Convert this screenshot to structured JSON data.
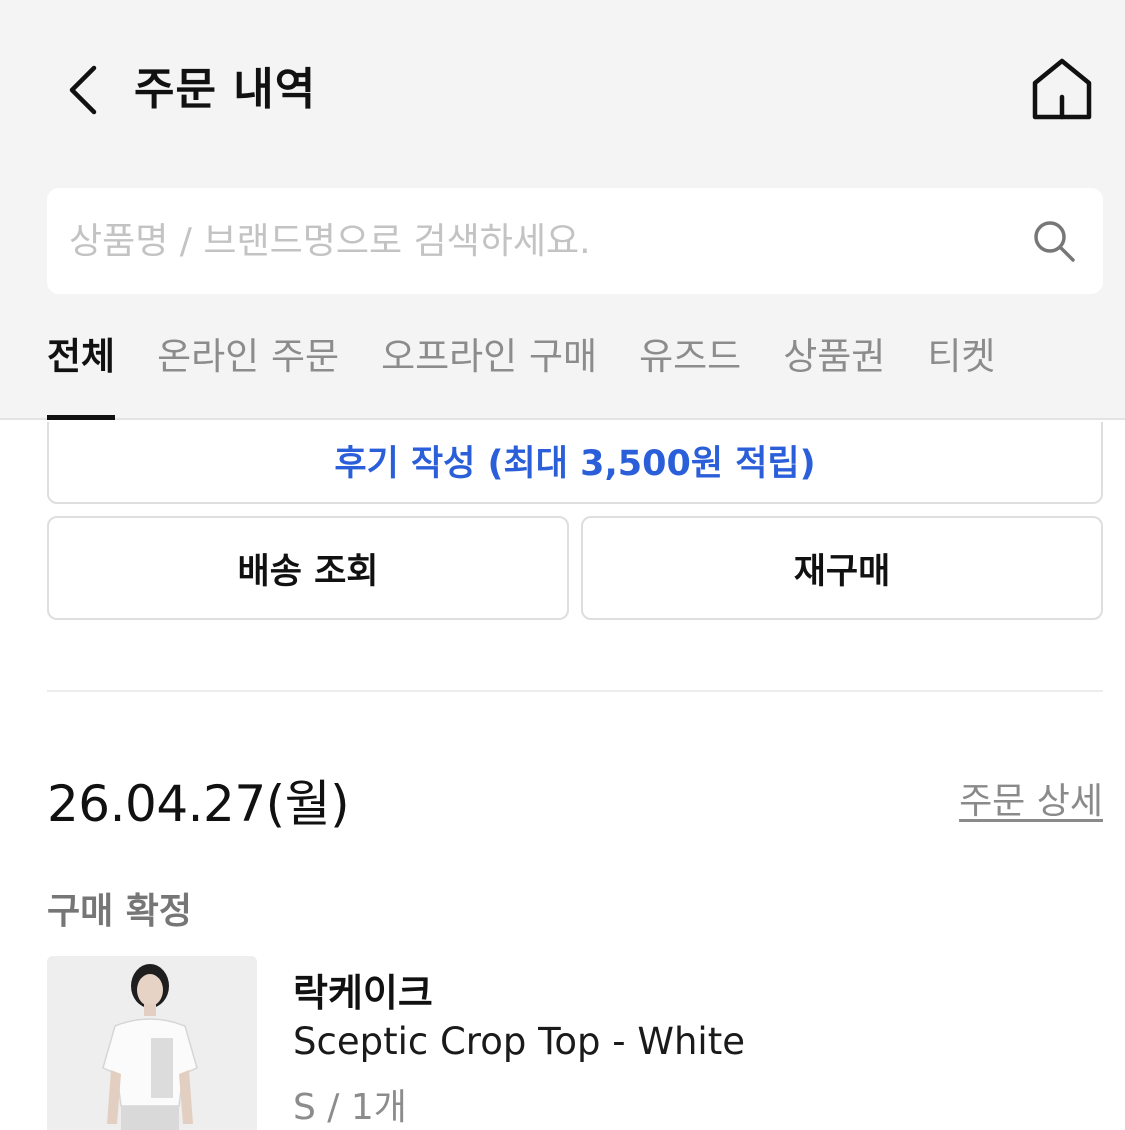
{
  "header": {
    "title": "주문 내역",
    "back_icon": "chevron-left-icon",
    "home_icon": "home-icon"
  },
  "search": {
    "placeholder": "상품명 / 브랜드명으로 검색하세요.",
    "value": "",
    "icon": "search-icon"
  },
  "tabs": [
    {
      "label": "전체",
      "active": true
    },
    {
      "label": "온라인 주문",
      "active": false
    },
    {
      "label": "오프라인 구매",
      "active": false
    },
    {
      "label": "유즈드",
      "active": false
    },
    {
      "label": "상품권",
      "active": false
    },
    {
      "label": "티켓",
      "active": false
    }
  ],
  "previous_order": {
    "review_button": "후기 작성 (최대 3,500원 적립)",
    "track_button": "배송 조회",
    "reorder_button": "재구매"
  },
  "order": {
    "date": "26.04.27(월)",
    "detail_link": "주문 상세",
    "status": "구매 확정",
    "item": {
      "brand": "락케이크",
      "name": "Sceptic Crop Top - White",
      "option": "S / 1개"
    }
  },
  "colors": {
    "accent_blue": "#2b5fd9",
    "header_bg": "#f4f4f4",
    "muted_text": "#8c8c8c"
  }
}
